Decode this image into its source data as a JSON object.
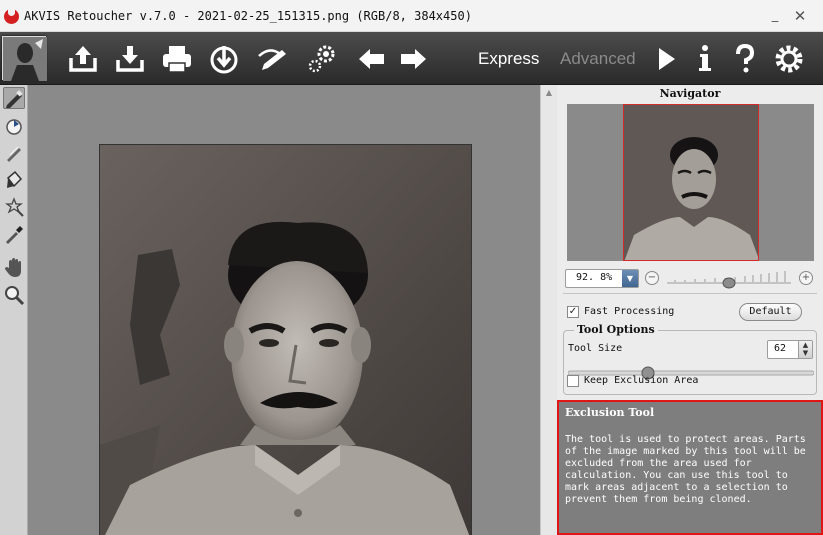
{
  "window": {
    "title": "AKVIS Retoucher v.7.0 - 2021-02-25_151315.png (RGB/8, 384x450)",
    "minimize_glyph": "_",
    "close_glyph": "✕"
  },
  "toolbar": {
    "buttons": [
      "open-icon",
      "save-icon",
      "print-icon",
      "import-icon",
      "eye-pencil-icon",
      "effects-gear-icon",
      "undo-arrow-icon",
      "redo-arrow-icon",
      "run-icon",
      "info-icon",
      "help-icon",
      "settings-gear-icon"
    ],
    "modes": {
      "express": "Express",
      "advanced": "Advanced"
    }
  },
  "tools": [
    "exclusion-pencil-icon",
    "selection-brush-icon",
    "clone-brush-icon",
    "fill-bucket-icon",
    "magic-wand-icon",
    "pipette-icon",
    "hand-icon",
    "zoom-icon"
  ],
  "navigator": {
    "title": "Navigator",
    "zoom_value": "92. 8%",
    "zoom_out": "−",
    "zoom_in": "+"
  },
  "settings": {
    "fast_processing": {
      "label": "Fast Processing",
      "checked": true
    },
    "default_label": "Default",
    "tool_options_title": "Tool Options",
    "tool_size_label": "Tool Size",
    "tool_size_value": "62",
    "keep_exclusion": {
      "label": "Keep Exclusion Area",
      "checked": false
    }
  },
  "help": {
    "title": "Exclusion Tool",
    "text": "The tool is used to protect areas. Parts of the image marked by this tool will be excluded from the area used for calculation. You can use this tool to mark areas adjacent to a selection to prevent them from being cloned."
  },
  "colors": {
    "accent_red": "#e01616",
    "toolbar_bg": "#3a3a3a",
    "canvas_bg": "#8a8a8a"
  }
}
